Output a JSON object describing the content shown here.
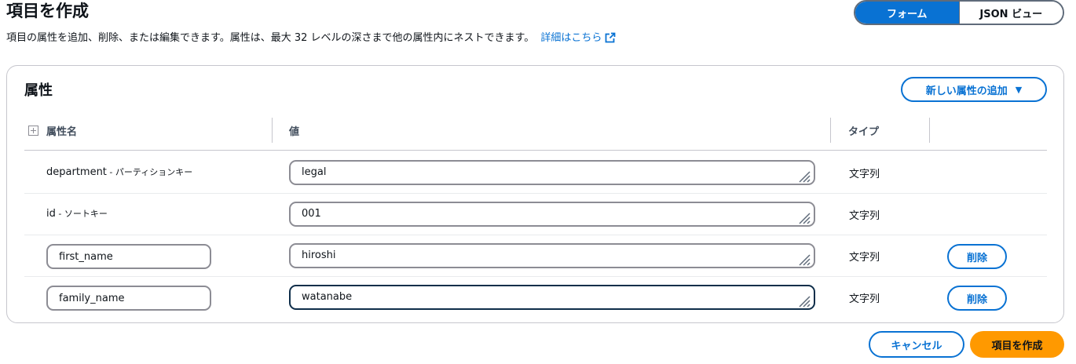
{
  "header": {
    "title": "項目を作成",
    "description": "項目の属性を追加、削除、または編集できます。属性は、最大 32 レベルの深さまで他の属性内にネストできます。",
    "learn_more": "詳細はこちら"
  },
  "view_toggle": {
    "form_label": "フォーム",
    "json_label": "JSON ビュー",
    "selected": "フォーム"
  },
  "attributes": {
    "title": "属性",
    "add_button": "新しい属性の追加",
    "columns": {
      "name": "属性名",
      "value": "値",
      "type": "タイプ"
    },
    "rows": [
      {
        "name": "department",
        "role": " - パーティションキー",
        "value": "legal",
        "type": "文字列"
      },
      {
        "name": "id",
        "role": " - ソートキー",
        "value": "001",
        "type": "文字列"
      },
      {
        "name": "first_name",
        "value": "hiroshi",
        "type": "文字列",
        "delete_label": "削除"
      },
      {
        "name": "family_name",
        "value": "watanabe",
        "type": "文字列",
        "delete_label": "削除"
      }
    ]
  },
  "footer": {
    "cancel": "キャンセル",
    "create": "項目を作成"
  },
  "colors": {
    "primary": "#0972d3",
    "create_button": "#ff9900",
    "border": "#8c8c94"
  },
  "icons": {
    "external_link": "external-link-icon",
    "expand": "expand-all-icon",
    "dropdown": "caret-down-icon",
    "resize": "resize-handle-icon"
  }
}
